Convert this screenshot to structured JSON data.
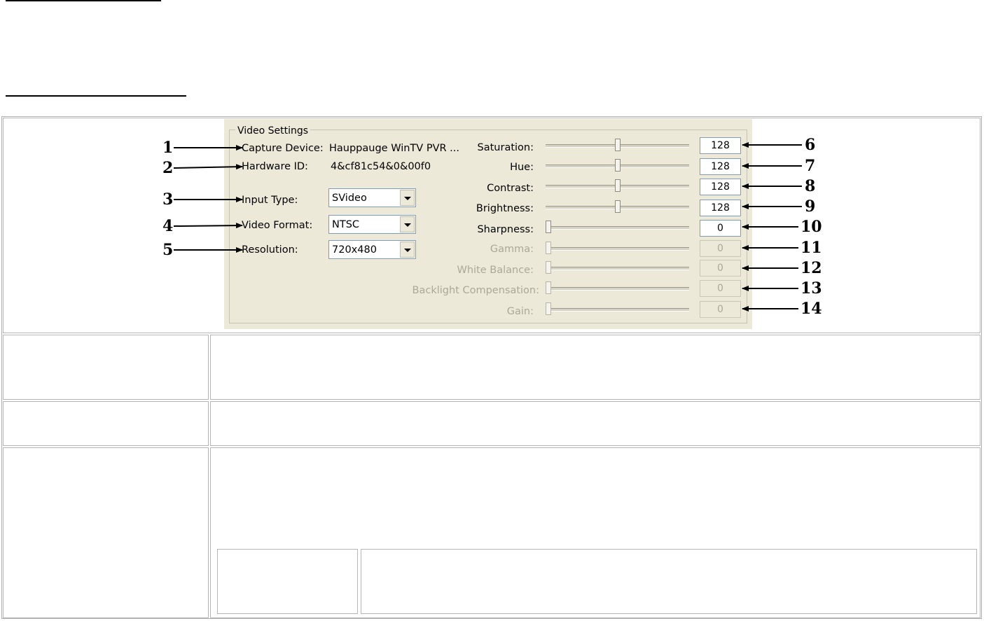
{
  "dialog": {
    "group_title": "Video Settings",
    "capture_device": {
      "label": "Capture Device:",
      "value": "Hauppauge WinTV PVR ..."
    },
    "hardware_id": {
      "label": "Hardware ID:",
      "value": "4&cf81c54&0&00f0"
    },
    "input_type": {
      "label": "Input Type:",
      "value": "SVideo"
    },
    "video_format": {
      "label": "Video Format:",
      "value": "NTSC"
    },
    "resolution": {
      "label": "Resolution:",
      "value": "720x480"
    },
    "sliders": [
      {
        "label": "Saturation:",
        "value": "128",
        "level": 0.5,
        "enabled": true
      },
      {
        "label": "Hue:",
        "value": "128",
        "level": 0.5,
        "enabled": true
      },
      {
        "label": "Contrast:",
        "value": "128",
        "level": 0.5,
        "enabled": true
      },
      {
        "label": "Brightness:",
        "value": "128",
        "level": 0.5,
        "enabled": true
      },
      {
        "label": "Sharpness:",
        "value": "0",
        "level": 0,
        "enabled": true
      },
      {
        "label": "Gamma:",
        "value": "0",
        "level": 0,
        "enabled": false
      },
      {
        "label": "White Balance:",
        "value": "0",
        "level": 0,
        "enabled": false
      },
      {
        "label": "Backlight Compensation:",
        "value": "0",
        "level": 0,
        "enabled": false
      },
      {
        "label": "Gain:",
        "value": "0",
        "level": 0,
        "enabled": false
      }
    ]
  },
  "callouts": {
    "left": [
      "1",
      "2",
      "3",
      "4",
      "5"
    ],
    "right": [
      "6",
      "7",
      "8",
      "9",
      "10",
      "11",
      "12",
      "13",
      "14"
    ]
  }
}
